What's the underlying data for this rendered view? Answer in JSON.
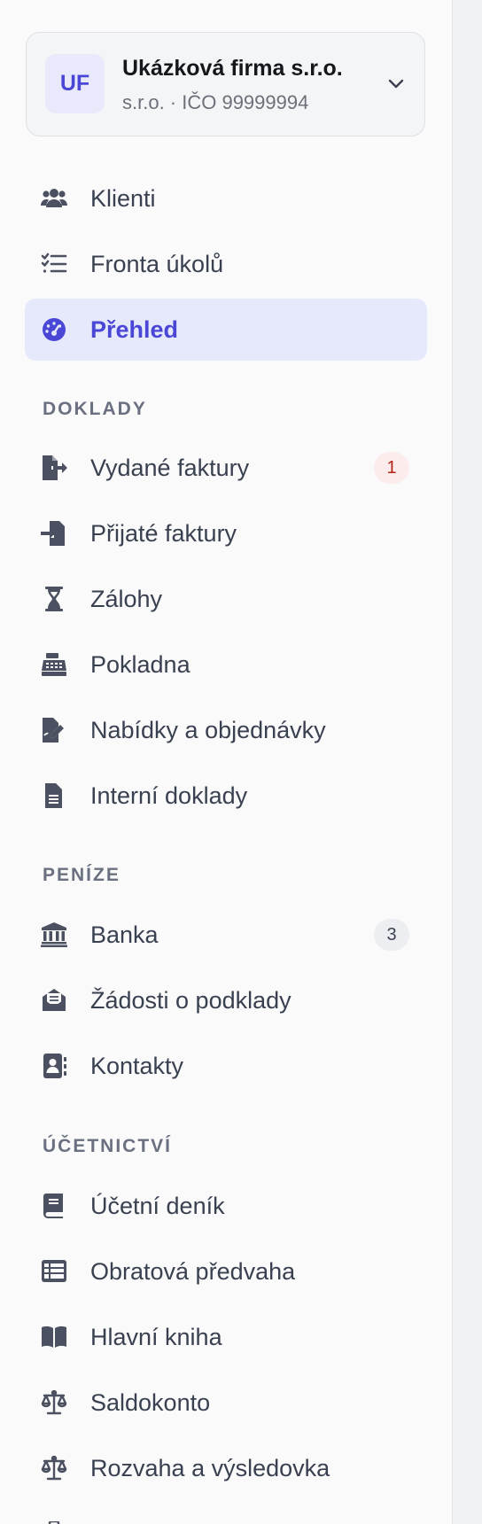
{
  "company": {
    "initials": "UF",
    "name": "Ukázková firma s.r.o.",
    "subtitle": "s.r.o. · IČO 99999994",
    "accent": "#4b47d6"
  },
  "nav_top": [
    {
      "label": "Klienti",
      "icon": "users-icon"
    },
    {
      "label": "Fronta úkolů",
      "icon": "task-list-icon"
    },
    {
      "label": "Přehled",
      "icon": "dashboard-gauge-icon",
      "active": true
    }
  ],
  "sections": {
    "doklady": "DOKLADY",
    "penize": "PENÍZE",
    "ucetnictvi": "ÚČETNICTVÍ"
  },
  "doklady_items": [
    {
      "label": "Vydané faktury",
      "icon": "file-export-icon",
      "badge": "1"
    },
    {
      "label": "Přijaté faktury",
      "icon": "file-import-icon"
    },
    {
      "label": "Zálohy",
      "icon": "hourglass-icon"
    },
    {
      "label": "Pokladna",
      "icon": "cash-register-icon"
    },
    {
      "label": "Nabídky a objednávky",
      "icon": "file-signature-icon"
    },
    {
      "label": "Interní doklady",
      "icon": "document-icon"
    }
  ],
  "penize_items": [
    {
      "label": "Banka",
      "icon": "bank-icon",
      "badge": "3"
    },
    {
      "label": "Žádosti o podklady",
      "icon": "envelope-open-icon"
    },
    {
      "label": "Kontakty",
      "icon": "address-book-icon"
    }
  ],
  "ucetnictvi_items": [
    {
      "label": "Účetní deník",
      "icon": "book-icon"
    },
    {
      "label": "Obratová předvaha",
      "icon": "table-list-icon"
    },
    {
      "label": "Hlavní kniha",
      "icon": "book-open-icon"
    },
    {
      "label": "Saldokonto",
      "icon": "scale-balanced-icon"
    },
    {
      "label": "Rozvaha a výsledovka",
      "icon": "scale-balanced-icon"
    }
  ]
}
